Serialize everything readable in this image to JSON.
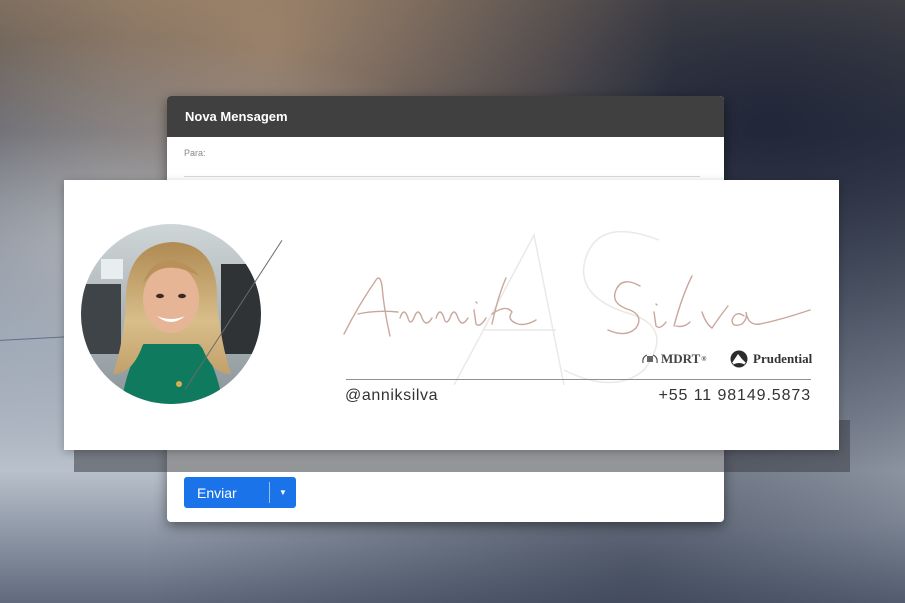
{
  "compose": {
    "title": "Nova Mensagem",
    "to_label": "Para:",
    "send_label": "Enviar",
    "send_color": "#1a73e8",
    "header_color": "#404040"
  },
  "signature": {
    "name_script": "Annik Silva",
    "monogram": "AS",
    "accent_color": "#c9a79c",
    "logos": {
      "mdrt": "MDRT",
      "mdrt_mark": "®",
      "prudential": "Prudential"
    },
    "handle": "@anniksilva",
    "phone": "+55 11 98149.5873"
  },
  "icons": {
    "send_dropdown": "caret-down-icon",
    "mdrt_logo": "mdrt-wreath-icon",
    "prudential_logo": "prudential-rock-icon"
  }
}
